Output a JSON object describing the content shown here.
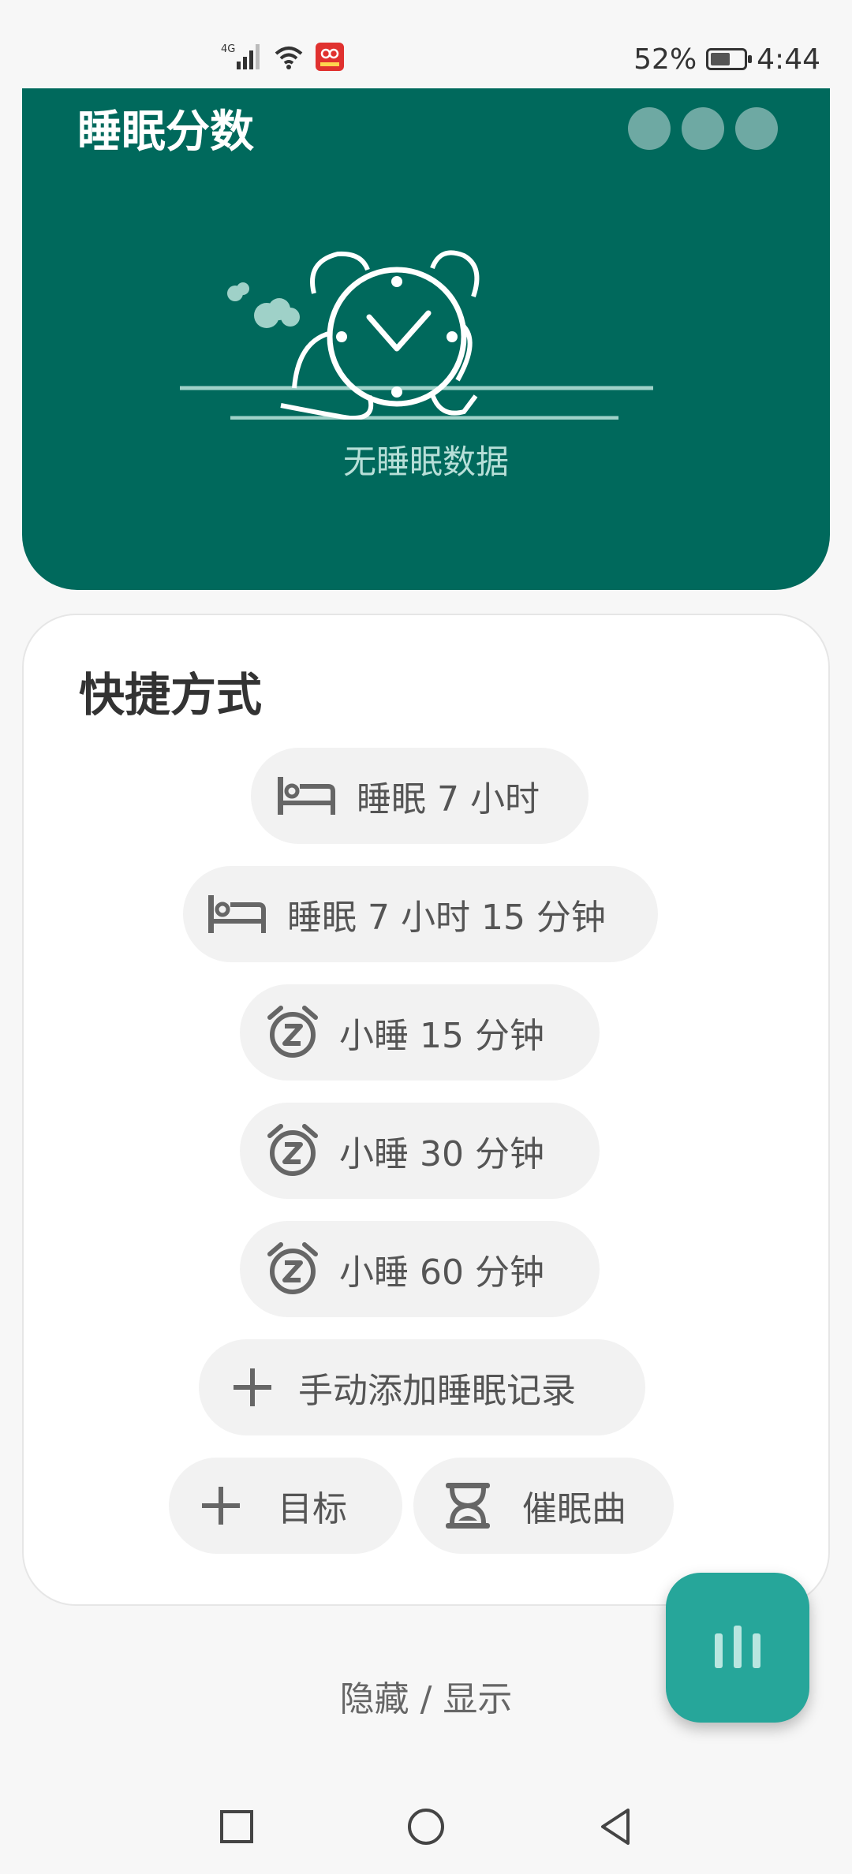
{
  "status_bar": {
    "network": "4G",
    "battery_percent": "52%",
    "time": "4:44"
  },
  "hero": {
    "title": "睡眠分数",
    "empty_text": "无睡眠数据",
    "background_color": "#00695c"
  },
  "shortcuts": {
    "title": "快捷方式",
    "items": [
      {
        "label": "睡眠 7 小时",
        "icon": "bed-icon"
      },
      {
        "label": "睡眠 7 小时 15 分钟",
        "icon": "bed-icon"
      },
      {
        "label": "小睡 15 分钟",
        "icon": "snooze-alarm-icon"
      },
      {
        "label": "小睡 30 分钟",
        "icon": "snooze-alarm-icon"
      },
      {
        "label": "小睡 60 分钟",
        "icon": "snooze-alarm-icon"
      },
      {
        "label": "手动添加睡眠记录",
        "icon": "plus-icon"
      },
      {
        "label": "目标",
        "icon": "plus-icon"
      },
      {
        "label": "催眠曲",
        "icon": "hourglass-icon"
      }
    ]
  },
  "toggle_text": "隐藏 / 显示",
  "fab_color": "#26a69a"
}
